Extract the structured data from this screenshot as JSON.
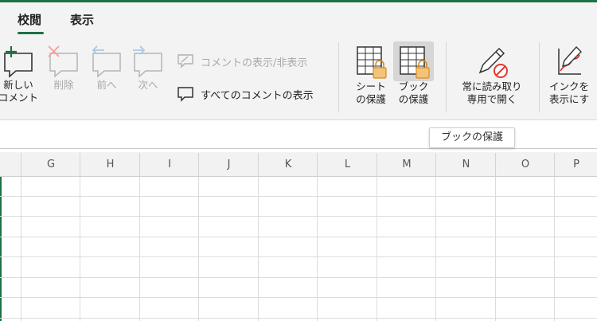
{
  "tabs": [
    {
      "label": "校閲",
      "active": true
    },
    {
      "label": "表示",
      "active": false
    }
  ],
  "ribbon": {
    "new_comment": {
      "line1": "新しい",
      "line2": "コメント"
    },
    "delete": "削除",
    "previous": "前へ",
    "next": "次へ",
    "show_hide_comment": "コメントの表示/非表示",
    "show_all_comments": "すべてのコメントの表示",
    "protect_sheet": {
      "line1": "シート",
      "line2": "の保護"
    },
    "protect_workbook": {
      "line1": "ブック",
      "line2": "の保護"
    },
    "always_open_readonly": {
      "line1": "常に読み取り",
      "line2": "専用で開く"
    },
    "ink_display": {
      "line1": "インクを",
      "line2": "表示にす"
    }
  },
  "tooltip": "ブックの保護",
  "columns": [
    "G",
    "H",
    "I",
    "J",
    "K",
    "L",
    "M",
    "N",
    "O",
    "P"
  ],
  "colors": {
    "accent": "#1e7145",
    "lock": "#e8a43a",
    "disabled": "#a9a9a9"
  }
}
